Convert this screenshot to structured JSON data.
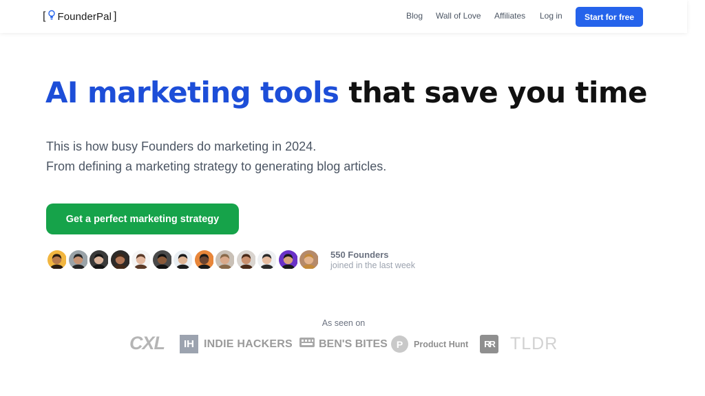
{
  "header": {
    "brand": {
      "open_bracket": "[",
      "name": "FounderPal",
      "close_bracket": "]",
      "icon": "lightbulb-icon"
    },
    "nav": [
      {
        "label": "Blog"
      },
      {
        "label": "Wall of Love"
      },
      {
        "label": "Affiliates"
      },
      {
        "label": "Log in"
      }
    ],
    "cta_label": "Start for free"
  },
  "hero": {
    "headline_accent": "AI marketing tools",
    "headline_rest": "that save you time",
    "subline_1": "This is how busy Founders do marketing in 2024.",
    "subline_2": "From defining a marketing strategy to generating blog articles.",
    "cta_label": "Get a perfect marketing strategy"
  },
  "social_proof": {
    "count_label": "550 Founders",
    "sub_label": "joined in the last week",
    "avatars": [
      {
        "bg": "#f2b640",
        "skin": "#b87a4b",
        "hair": "#2b1d12"
      },
      {
        "bg": "#9aa3a8",
        "skin": "#c69373",
        "hair": "#262626"
      },
      {
        "bg": "#3a3a3a",
        "skin": "#d8b29a",
        "hair": "#151515"
      },
      {
        "bg": "#2d2a28",
        "skin": "#b07555",
        "hair": "#402818"
      },
      {
        "bg": "#f5f5f5",
        "skin": "#e3b9a0",
        "hair": "#5a3a28"
      },
      {
        "bg": "#4a4a4a",
        "skin": "#8a5a3a",
        "hair": "#111111"
      },
      {
        "bg": "#e9eef2",
        "skin": "#e0b696",
        "hair": "#1c1c1c"
      },
      {
        "bg": "#e8863a",
        "skin": "#6b4430",
        "hair": "#1a1a1a"
      },
      {
        "bg": "#c9c0b6",
        "skin": "#d9a98a",
        "hair": "#8a6a4a"
      },
      {
        "bg": "#d9d4cf",
        "skin": "#c98f6d",
        "hair": "#4a2a18"
      },
      {
        "bg": "#eef0f2",
        "skin": "#e6bca0",
        "hair": "#2a2a2a"
      },
      {
        "bg": "#6a32c8",
        "skin": "#d8a37e",
        "hair": "#1a1a1a"
      },
      {
        "bg": "#b58a6a",
        "skin": "#e4b48e",
        "hair": "#c48a3a"
      }
    ]
  },
  "press": {
    "label": "As seen on",
    "logos": {
      "cxl": "CXL",
      "indie_hackers_mark": "IH",
      "indie_hackers": "INDIE HACKERS",
      "bens_bites": "BEN'S BITES",
      "product_hunt_mark": "P",
      "product_hunt": "Product Hunt",
      "rr_mark": "RR",
      "tldr": "TLDR"
    }
  },
  "colors": {
    "primary_blue": "#2563eb",
    "headline_blue": "#1d4ed8",
    "green": "#16a34a"
  }
}
